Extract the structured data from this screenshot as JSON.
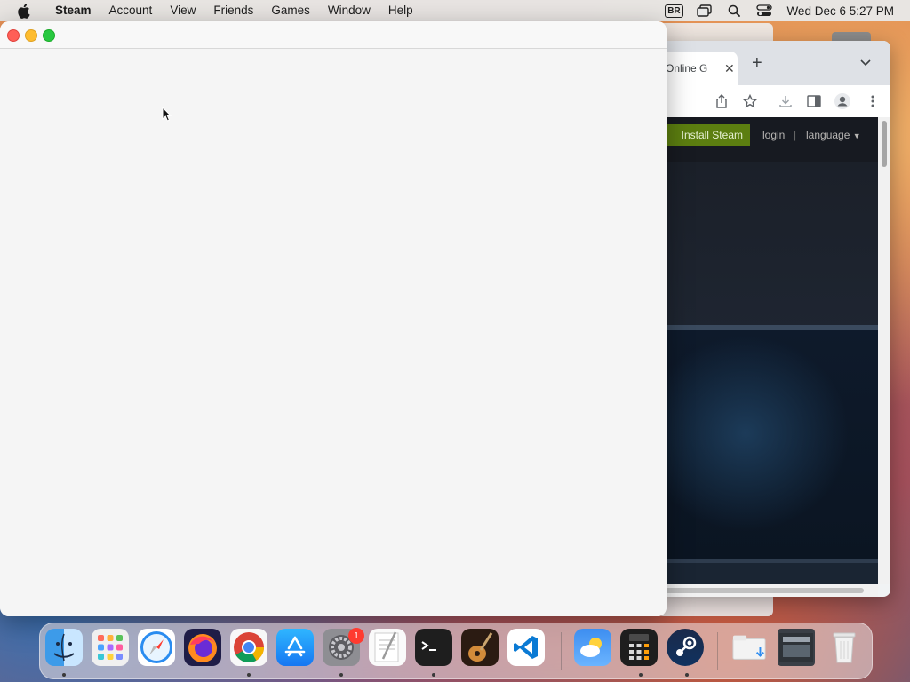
{
  "menubar": {
    "app_name": "Steam",
    "items": [
      "Account",
      "View",
      "Friends",
      "Games",
      "Window",
      "Help"
    ],
    "input_badge": "BR",
    "clock": "Wed Dec 6  5:27 PM"
  },
  "browser": {
    "tab_title": "Online G",
    "new_tab": "+",
    "steam_page": {
      "install_label": "Install Steam",
      "login_label": "login",
      "separator": "|",
      "language_label": "language"
    }
  },
  "dock": {
    "apps": [
      "finder-icon",
      "launchpad-icon",
      "safari-icon",
      "firefox-icon",
      "chrome-icon",
      "app-store-icon",
      "system-settings-icon",
      "textedit-icon",
      "terminal-icon",
      "garageband-icon",
      "vscode-icon",
      "weather-icon",
      "calculator-icon",
      "steam-icon",
      "downloads-folder-icon",
      "document-thumbnail-icon",
      "trash-icon"
    ],
    "settings_badge": "1"
  },
  "colors": {
    "steam_green": "#5c7e10",
    "steam_dark": "#171a21",
    "accent_red": "#ff5f57"
  }
}
